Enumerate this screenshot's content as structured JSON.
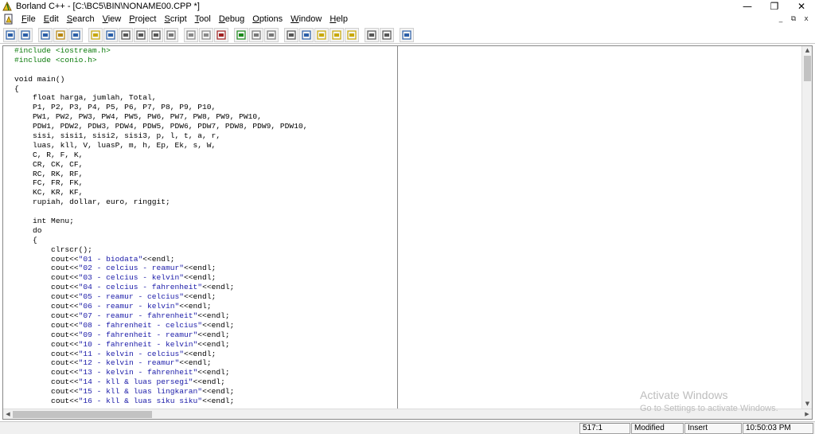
{
  "window": {
    "title": "Borland C++ - [C:\\BC5\\BIN\\NONAME00.CPP *]",
    "minimize_glyph": "—",
    "restore_glyph": "❐",
    "close_glyph": "✕"
  },
  "menu": {
    "items": [
      {
        "u": "F",
        "rest": "ile"
      },
      {
        "u": "E",
        "rest": "dit"
      },
      {
        "u": "S",
        "rest": "earch"
      },
      {
        "u": "V",
        "rest": "iew"
      },
      {
        "u": "P",
        "rest": "roject"
      },
      {
        "u": "S",
        "rest": "cript"
      },
      {
        "u": "T",
        "rest": "ool"
      },
      {
        "u": "D",
        "rest": "ebug"
      },
      {
        "u": "O",
        "rest": "ptions"
      },
      {
        "u": "W",
        "rest": "indow"
      },
      {
        "u": "H",
        "rest": "elp"
      }
    ],
    "mdi_min": "_",
    "mdi_restore": "⧉",
    "mdi_close": "x"
  },
  "toolbar": {
    "icons": [
      "open-project-icon",
      "save-project-icon",
      "new-file-icon",
      "open-file-icon",
      "save-file-icon",
      "compile-icon",
      "make-icon",
      "run-icon",
      "step-over-icon",
      "trace-into-icon",
      "toggle-breakpoint-icon",
      "stop-icon",
      "pause-icon",
      "add-watch-icon",
      "back-icon",
      "cut-icon",
      "copy-icon",
      "paste-icon",
      "find-icon",
      "find-next-icon",
      "replace-icon",
      "search-again-icon",
      "view-window-icon",
      "view-list-icon",
      "help-icon"
    ]
  },
  "editor": {
    "lines": [
      [
        {
          "t": "#include <iostream.h>",
          "c": "pp"
        }
      ],
      [
        {
          "t": "#include <conio.h>",
          "c": "pp"
        }
      ],
      [
        {
          "t": "",
          "c": ""
        }
      ],
      [
        {
          "t": "void main()",
          "c": ""
        }
      ],
      [
        {
          "t": "{",
          "c": ""
        }
      ],
      [
        {
          "t": "    float harga, jumlah, Total,",
          "c": ""
        }
      ],
      [
        {
          "t": "    P1, P2, P3, P4, P5, P6, P7, P8, P9, P10,",
          "c": ""
        }
      ],
      [
        {
          "t": "    PW1, PW2, PW3, PW4, PW5, PW6, PW7, PW8, PW9, PW10,",
          "c": ""
        }
      ],
      [
        {
          "t": "    PDW1, PDW2, PDW3, PDW4, PDW5, PDW6, PDW7, PDW8, PDW9, PDW10,",
          "c": ""
        }
      ],
      [
        {
          "t": "    sisi, sisi1, sisi2, sisi3, p, l, t, a, r,",
          "c": ""
        }
      ],
      [
        {
          "t": "    luas, kll, V, luasP, m, h, Ep, Ek, s, W,",
          "c": ""
        }
      ],
      [
        {
          "t": "    C, R, F, K,",
          "c": ""
        }
      ],
      [
        {
          "t": "    CR, CK, CF,",
          "c": ""
        }
      ],
      [
        {
          "t": "    RC, RK, RF,",
          "c": ""
        }
      ],
      [
        {
          "t": "    FC, FR, FK,",
          "c": ""
        }
      ],
      [
        {
          "t": "    KC, KR, KF,",
          "c": ""
        }
      ],
      [
        {
          "t": "    rupiah, dollar, euro, ringgit;",
          "c": ""
        }
      ],
      [
        {
          "t": "",
          "c": ""
        }
      ],
      [
        {
          "t": "    int Menu;",
          "c": ""
        }
      ],
      [
        {
          "t": "    do",
          "c": ""
        }
      ],
      [
        {
          "t": "    {",
          "c": ""
        }
      ],
      [
        {
          "t": "        clrscr();",
          "c": ""
        }
      ],
      [
        {
          "t": "        cout<<",
          "c": ""
        },
        {
          "t": "\"01 - biodata\"",
          "c": "str"
        },
        {
          "t": "<<endl;",
          "c": ""
        }
      ],
      [
        {
          "t": "        cout<<",
          "c": ""
        },
        {
          "t": "\"02 - celcius - reamur\"",
          "c": "str"
        },
        {
          "t": "<<endl;",
          "c": ""
        }
      ],
      [
        {
          "t": "        cout<<",
          "c": ""
        },
        {
          "t": "\"03 - celcius - kelvin\"",
          "c": "str"
        },
        {
          "t": "<<endl;",
          "c": ""
        }
      ],
      [
        {
          "t": "        cout<<",
          "c": ""
        },
        {
          "t": "\"04 - celcius - fahrenheit\"",
          "c": "str"
        },
        {
          "t": "<<endl;",
          "c": ""
        }
      ],
      [
        {
          "t": "        cout<<",
          "c": ""
        },
        {
          "t": "\"05 - reamur - celcius\"",
          "c": "str"
        },
        {
          "t": "<<endl;",
          "c": ""
        }
      ],
      [
        {
          "t": "        cout<<",
          "c": ""
        },
        {
          "t": "\"06 - reamur - kelvin\"",
          "c": "str"
        },
        {
          "t": "<<endl;",
          "c": ""
        }
      ],
      [
        {
          "t": "        cout<<",
          "c": ""
        },
        {
          "t": "\"07 - reamur - fahrenheit\"",
          "c": "str"
        },
        {
          "t": "<<endl;",
          "c": ""
        }
      ],
      [
        {
          "t": "        cout<<",
          "c": ""
        },
        {
          "t": "\"08 - fahrenheit - celcius\"",
          "c": "str"
        },
        {
          "t": "<<endl;",
          "c": ""
        }
      ],
      [
        {
          "t": "        cout<<",
          "c": ""
        },
        {
          "t": "\"09 - fahrenheit - reamur\"",
          "c": "str"
        },
        {
          "t": "<<endl;",
          "c": ""
        }
      ],
      [
        {
          "t": "        cout<<",
          "c": ""
        },
        {
          "t": "\"10 - fahrenheit - kelvin\"",
          "c": "str"
        },
        {
          "t": "<<endl;",
          "c": ""
        }
      ],
      [
        {
          "t": "        cout<<",
          "c": ""
        },
        {
          "t": "\"11 - kelvin - celcius\"",
          "c": "str"
        },
        {
          "t": "<<endl;",
          "c": ""
        }
      ],
      [
        {
          "t": "        cout<<",
          "c": ""
        },
        {
          "t": "\"12 - kelvin - reamur\"",
          "c": "str"
        },
        {
          "t": "<<endl;",
          "c": ""
        }
      ],
      [
        {
          "t": "        cout<<",
          "c": ""
        },
        {
          "t": "\"13 - kelvin - fahrenheit\"",
          "c": "str"
        },
        {
          "t": "<<endl;",
          "c": ""
        }
      ],
      [
        {
          "t": "        cout<<",
          "c": ""
        },
        {
          "t": "\"14 - kll & luas persegi\"",
          "c": "str"
        },
        {
          "t": "<<endl;",
          "c": ""
        }
      ],
      [
        {
          "t": "        cout<<",
          "c": ""
        },
        {
          "t": "\"15 - kll & luas lingkaran\"",
          "c": "str"
        },
        {
          "t": "<<endl;",
          "c": ""
        }
      ],
      [
        {
          "t": "        cout<<",
          "c": ""
        },
        {
          "t": "\"16 - kll & luas siku siku\"",
          "c": "str"
        },
        {
          "t": "<<endl;",
          "c": ""
        }
      ]
    ]
  },
  "watermark": {
    "line1": "Activate Windows",
    "line2": "Go to Settings to activate Windows."
  },
  "status": {
    "position": "517:1",
    "modified": "Modified",
    "mode": "Insert",
    "time": "10:50:03 PM"
  },
  "colors": {
    "preprocessor": "#0a7a0a",
    "string": "#1a1aa8"
  }
}
